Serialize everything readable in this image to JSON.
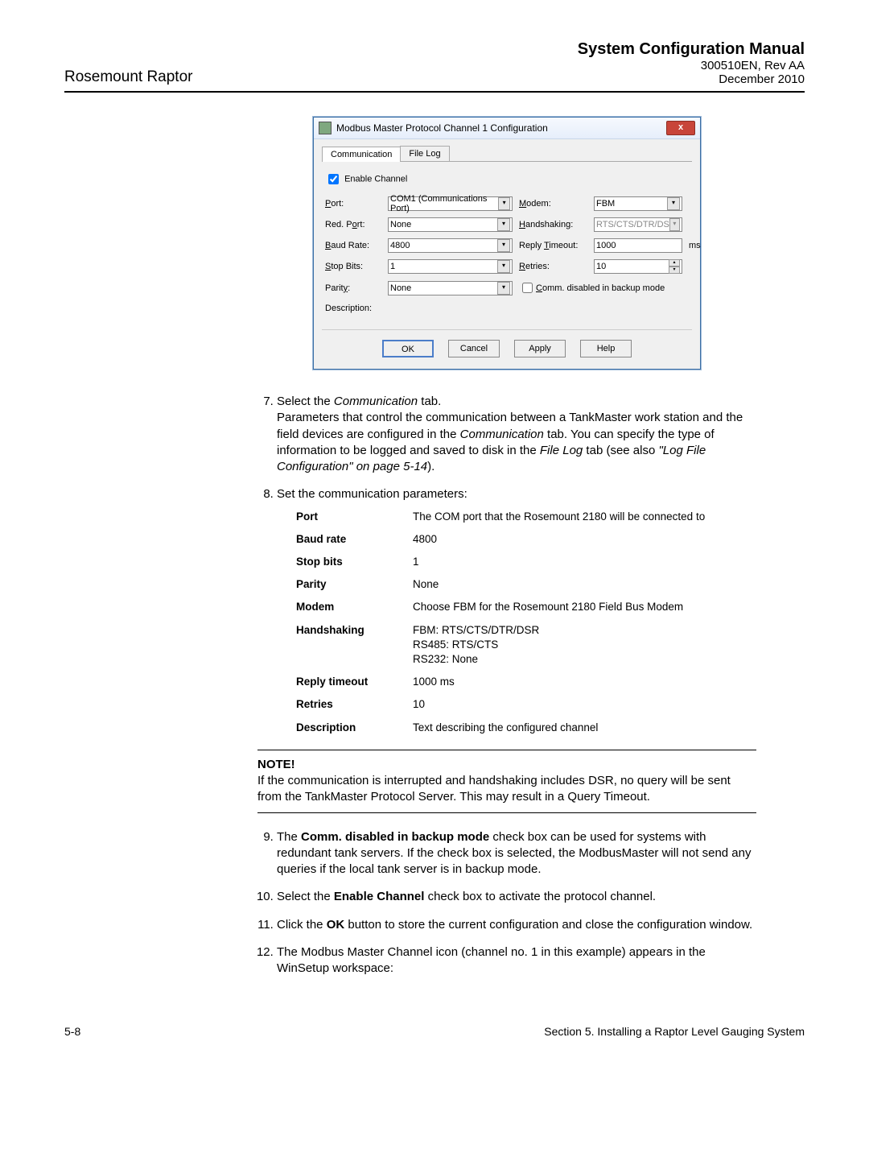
{
  "header": {
    "left": "Rosemount Raptor",
    "title": "System Configuration Manual",
    "sub1": "300510EN, Rev AA",
    "sub2": "December 2010"
  },
  "dialog": {
    "title": "Modbus Master Protocol Channel 1 Configuration",
    "close": "x",
    "tab_comm": "Communication",
    "tab_log": "File Log",
    "enable_label": "Enable Channel",
    "labels": {
      "port": "Port:",
      "redport": "Red. Port:",
      "baud": "Baud Rate:",
      "stopbits": "Stop Bits:",
      "parity": "Parity:",
      "modem": "Modem:",
      "handshaking": "Handshaking:",
      "replytimeout": "Reply Timeout:",
      "retries": "Retries:",
      "commdisabled": "Comm. disabled in backup mode",
      "description": "Description:"
    },
    "values": {
      "port": "COM1 (Communications Port)",
      "redport": "None",
      "baud": "4800",
      "stopbits": "1",
      "parity": "None",
      "modem": "FBM",
      "handshaking": "RTS/CTS/DTR/DS",
      "replytimeout": "1000",
      "retries": "10",
      "ms": "ms"
    },
    "buttons": {
      "ok": "OK",
      "cancel": "Cancel",
      "apply": "Apply",
      "help": "Help"
    }
  },
  "steps": {
    "s7a": "Select the ",
    "s7b": "Communication",
    "s7c": " tab.",
    "s7d": "Parameters that control the communication between a TankMaster work station and the field devices are configured in the ",
    "s7e": "Communication",
    "s7f": " tab. You can specify the type of information to be logged and saved to disk in the ",
    "s7g": "File Log",
    "s7h": " tab (see also ",
    "s7i": "\"Log File Configuration\" on page 5-14",
    "s7j": ").",
    "s8": "Set the communication parameters:",
    "s9a": "The ",
    "s9b": "Comm. disabled in backup mode",
    "s9c": " check box can be used for systems with redundant tank servers. If the check box is selected, the ModbusMaster will not send any queries if the local tank server is in backup mode.",
    "s10a": "Select the ",
    "s10b": "Enable Channel",
    "s10c": " check box to activate the protocol channel.",
    "s11a": "Click the ",
    "s11b": "OK",
    "s11c": " button to store the current configuration and close the configuration window.",
    "s12": "The Modbus Master Channel icon (channel no. 1 in this example) appears in the WinSetup workspace:"
  },
  "params": [
    {
      "k": "Port",
      "v": "The COM port that the Rosemount 2180 will be connected to"
    },
    {
      "k": "Baud rate",
      "v": "4800"
    },
    {
      "k": "Stop bits",
      "v": "1"
    },
    {
      "k": "Parity",
      "v": "None"
    },
    {
      "k": "Modem",
      "v": "Choose FBM for the Rosemount 2180 Field Bus Modem"
    },
    {
      "k": "Handshaking",
      "v": "FBM: RTS/CTS/DTR/DSR\nRS485: RTS/CTS\nRS232: None"
    },
    {
      "k": "Reply timeout",
      "v": "1000 ms"
    },
    {
      "k": "Retries",
      "v": "10"
    },
    {
      "k": "Description",
      "v": "Text describing the configured channel"
    }
  ],
  "note": {
    "head": "NOTE!",
    "body": "If the communication is interrupted and handshaking includes DSR, no query will be sent from the TankMaster Protocol Server. This may result in a Query Timeout."
  },
  "footer": {
    "left": "5-8",
    "right": "Section 5. Installing a Raptor Level Gauging System"
  }
}
